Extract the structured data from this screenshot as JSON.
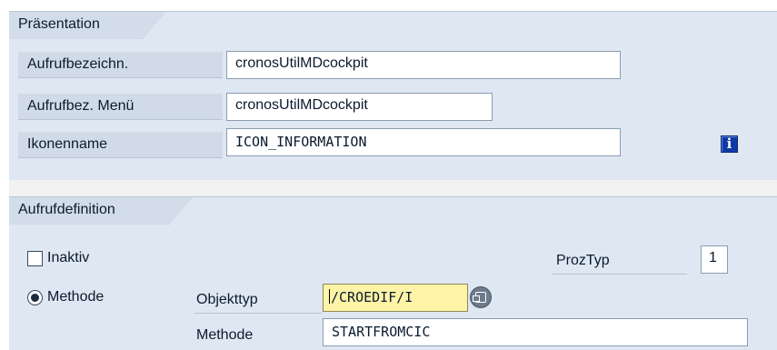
{
  "presentation": {
    "group_title": "Präsentation",
    "rows": [
      {
        "label": "Aufrufbezeichn.",
        "value": "cronosUtilMDcockpit"
      },
      {
        "label": "Aufrufbez. Menü",
        "value": "cronosUtilMDcockpit"
      },
      {
        "label": "Ikonenname",
        "value": "ICON_INFORMATION"
      }
    ],
    "icon_preview": "information-icon"
  },
  "definition": {
    "group_title": "Aufrufdefinition",
    "inaktiv_label": "Inaktiv",
    "inaktiv_checked": false,
    "proztyp_label": "ProzTyp",
    "proztyp_value": "1",
    "methode_radio_label": "Methode",
    "methode_radio_selected": true,
    "objekttyp_label": "Objekttyp",
    "objekttyp_value": "/CROEDIF/I",
    "methode_label": "Methode",
    "methode_value": "STARTFROMCIC"
  },
  "colors": {
    "panel_bg": "#dfe7f2",
    "label_bg": "#d1dbe8",
    "highlight_field": "#fef3a6",
    "icon_blue": "#0f3aa6"
  }
}
